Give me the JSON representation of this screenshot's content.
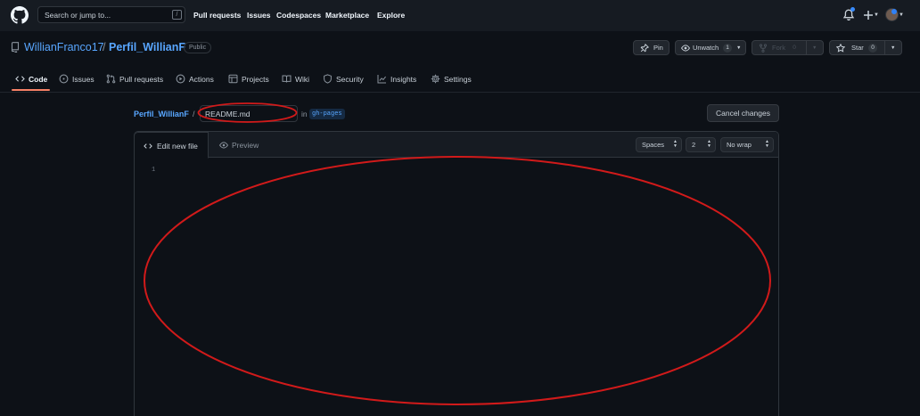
{
  "global_header": {
    "search_placeholder": "Search or jump to...",
    "search_shortcut": "/",
    "nav": [
      "Pull requests",
      "Issues",
      "Codespaces",
      "Marketplace",
      "Explore"
    ]
  },
  "repo": {
    "owner": "WillianFranco17",
    "separator": "/",
    "name": "Perfil_WillianF",
    "visibility": "Public",
    "actions": {
      "pin": "Pin",
      "watch": {
        "label": "Unwatch",
        "count": "1"
      },
      "fork": {
        "label": "Fork",
        "count": "0"
      },
      "star": {
        "label": "Star",
        "count": "0"
      }
    },
    "tabs": [
      {
        "label": "Code",
        "icon": "code-icon",
        "selected": true
      },
      {
        "label": "Issues",
        "icon": "issue-opened-icon"
      },
      {
        "label": "Pull requests",
        "icon": "git-pull-request-icon"
      },
      {
        "label": "Actions",
        "icon": "play-icon"
      },
      {
        "label": "Projects",
        "icon": "table-icon"
      },
      {
        "label": "Wiki",
        "icon": "book-icon"
      },
      {
        "label": "Security",
        "icon": "shield-icon"
      },
      {
        "label": "Insights",
        "icon": "graph-icon"
      },
      {
        "label": "Settings",
        "icon": "gear-icon"
      }
    ]
  },
  "file": {
    "breadcrumb_repo": "Perfil_WillianF",
    "path_separator": "/",
    "filename": "README.md",
    "in_label": "in",
    "branch": "gh-pages",
    "cancel_label": "Cancel changes"
  },
  "editor": {
    "tab_edit": "Edit new file",
    "tab_preview": "Preview",
    "indent_mode": "Spaces",
    "indent_size": "2",
    "wrap_mode": "No wrap",
    "line_numbers": [
      "1"
    ],
    "content": ""
  },
  "colors": {
    "background": "#0d1117",
    "header": "#161b22",
    "link": "#58a6ff",
    "selected_tab_underline": "#f78166",
    "annotation": "#d11a1a"
  }
}
